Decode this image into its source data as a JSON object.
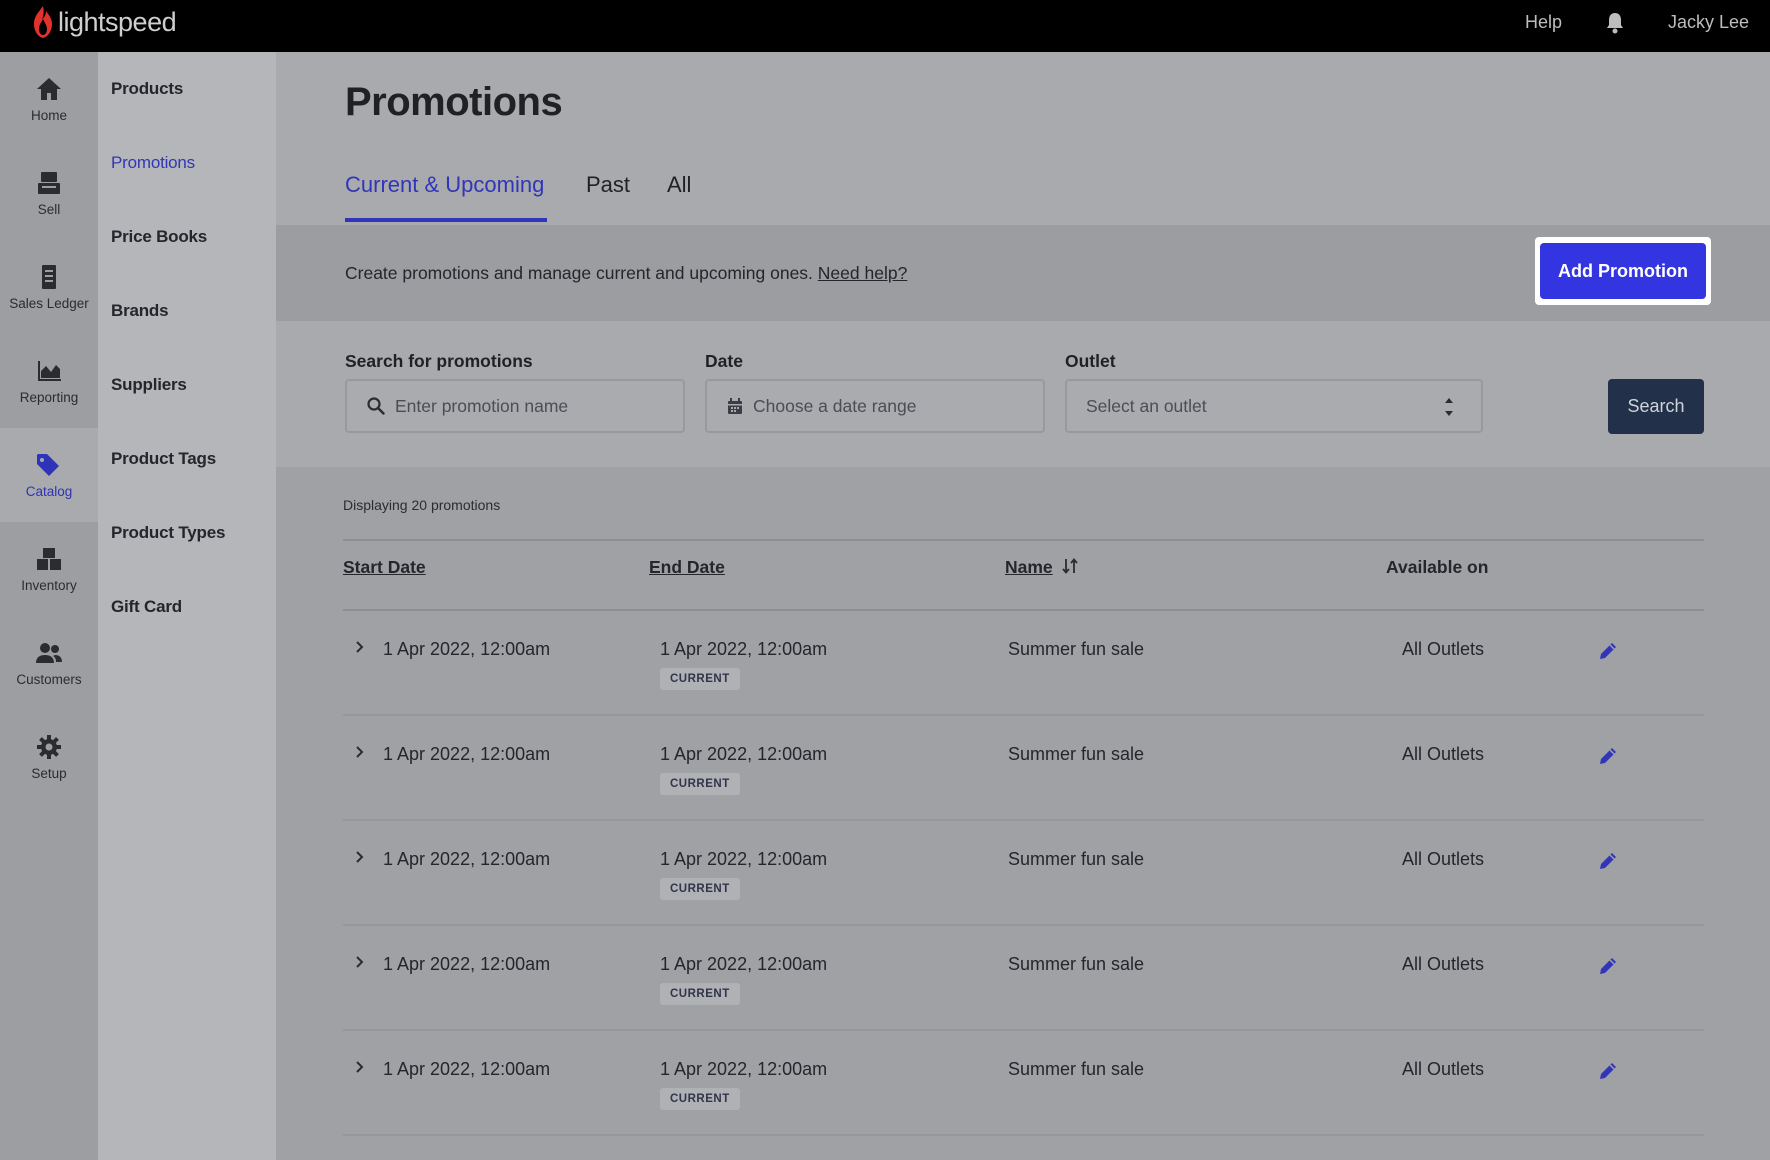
{
  "topbar": {
    "brand": "lightspeed",
    "help_label": "Help",
    "user_name": "Jacky Lee"
  },
  "rail": {
    "items": [
      {
        "label": "Home",
        "icon": "home-icon"
      },
      {
        "label": "Sell",
        "icon": "register-icon"
      },
      {
        "label": "Sales Ledger",
        "icon": "ledger-icon"
      },
      {
        "label": "Reporting",
        "icon": "chart-icon"
      },
      {
        "label": "Catalog",
        "icon": "tag-icon",
        "active": true
      },
      {
        "label": "Inventory",
        "icon": "boxes-icon"
      },
      {
        "label": "Customers",
        "icon": "people-icon"
      },
      {
        "label": "Setup",
        "icon": "gear-icon"
      }
    ]
  },
  "subnav": {
    "items": [
      {
        "label": "Products"
      },
      {
        "label": "Promotions",
        "active": true
      },
      {
        "label": "Price Books"
      },
      {
        "label": "Brands"
      },
      {
        "label": "Suppliers"
      },
      {
        "label": "Product Tags"
      },
      {
        "label": "Product Types"
      },
      {
        "label": "Gift Card"
      }
    ]
  },
  "page": {
    "title": "Promotions",
    "tabs": [
      {
        "label": "Current & Upcoming",
        "active": true
      },
      {
        "label": "Past"
      },
      {
        "label": "All"
      }
    ],
    "banner_text": "Create promotions and manage current and upcoming ones.",
    "banner_link": "Need help?",
    "add_button": "Add Promotion"
  },
  "filters": {
    "search_label": "Search for promotions",
    "search_placeholder": "Enter promotion name",
    "date_label": "Date",
    "date_placeholder": "Choose a date range",
    "outlet_label": "Outlet",
    "outlet_placeholder": "Select an outlet",
    "search_button": "Search"
  },
  "table": {
    "count_text": "Displaying 20 promotions",
    "headers": {
      "start": "Start Date",
      "end": "End Date",
      "name": "Name",
      "available": "Available on"
    },
    "rows": [
      {
        "start": "1 Apr 2022, 12:00am",
        "end": "1 Apr 2022, 12:00am",
        "status": "CURRENT",
        "name": "Summer fun sale",
        "available": "All Outlets"
      },
      {
        "start": "1 Apr 2022, 12:00am",
        "end": "1 Apr 2022, 12:00am",
        "status": "CURRENT",
        "name": "Summer fun sale",
        "available": "All Outlets"
      },
      {
        "start": "1 Apr 2022, 12:00am",
        "end": "1 Apr 2022, 12:00am",
        "status": "CURRENT",
        "name": "Summer fun sale",
        "available": "All Outlets"
      },
      {
        "start": "1 Apr 2022, 12:00am",
        "end": "1 Apr 2022, 12:00am",
        "status": "CURRENT",
        "name": "Summer fun sale",
        "available": "All Outlets"
      },
      {
        "start": "1 Apr 2022, 12:00am",
        "end": "1 Apr 2022, 12:00am",
        "status": "CURRENT",
        "name": "Summer fun sale",
        "available": "All Outlets"
      }
    ]
  },
  "colors": {
    "accent": "#3235e0",
    "active_text": "#3136b8",
    "topbar": "#000000",
    "search_button": "#223149",
    "brand_flame": "#e3322b"
  }
}
